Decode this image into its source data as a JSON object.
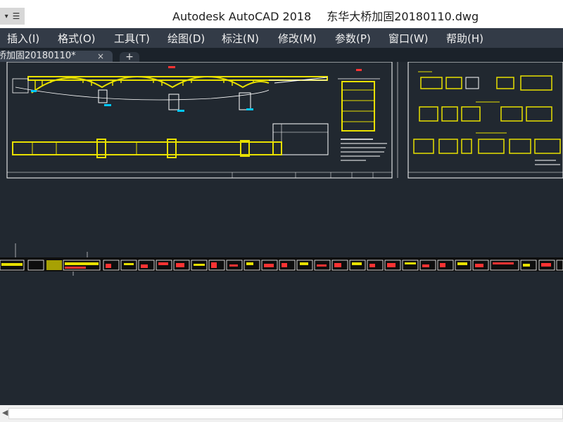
{
  "titlebar": {
    "app_title": "Autodesk AutoCAD 2018",
    "file_name": "东华大桥加固20180110.dwg",
    "quick_access_icon": "dropdown-arrow-icon"
  },
  "menubar": {
    "items": [
      "插入(I)",
      "格式(O)",
      "工具(T)",
      "绘图(D)",
      "标注(N)",
      "修改(M)",
      "参数(P)",
      "窗口(W)",
      "帮助(H)"
    ]
  },
  "tabs": {
    "active_label": "桥加固20180110*",
    "close_glyph": "×",
    "new_tab_glyph": "+"
  },
  "colors": {
    "accent_yellow": "#e8e000",
    "drawing_white": "#ffffff",
    "canvas_bg": "#212830",
    "menubar_bg": "#333b47"
  },
  "scrollbar": {
    "left_arrow_icon": "scroll-left-arrow-icon"
  }
}
